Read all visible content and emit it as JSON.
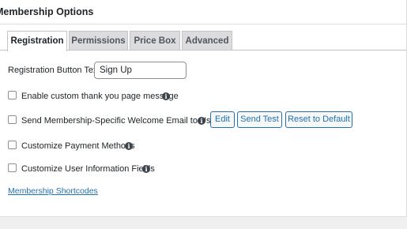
{
  "panel": {
    "title": "Membership Options"
  },
  "tabs": [
    {
      "label": "Registration",
      "active": true
    },
    {
      "label": "Permissions",
      "active": false
    },
    {
      "label": "Price Box",
      "active": false
    },
    {
      "label": "Advanced",
      "active": false
    }
  ],
  "registration": {
    "button_text_label": "Registration Button Text:",
    "button_text_value": "Sign Up",
    "options": [
      {
        "label": "Enable custom thank you page message",
        "checked": false,
        "info": "info-icon"
      },
      {
        "label": "Send Membership-Specific Welcome Email to User",
        "checked": false,
        "info": "info-icon"
      },
      {
        "label": "Customize Payment Methods",
        "checked": false,
        "info": "info-icon"
      },
      {
        "label": "Customize User Information Fields",
        "checked": false,
        "info": "info-icon"
      }
    ],
    "email_buttons": {
      "edit": "Edit",
      "send_test": "Send Test",
      "reset": "Reset to Default"
    },
    "shortcodes_link": "Membership Shortcodes"
  },
  "colors": {
    "accent": "#2271b1",
    "tab_inactive_bg": "#dcdcde",
    "page_bg": "#f0f0f1"
  }
}
